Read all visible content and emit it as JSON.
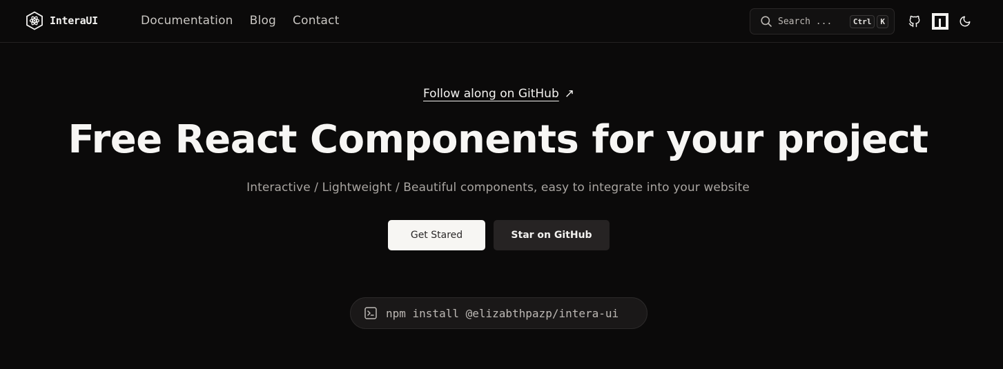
{
  "brand": {
    "name": "InteraUI",
    "logo_icon": "hexagon-atom-logo"
  },
  "nav": {
    "items": [
      {
        "label": "Documentation"
      },
      {
        "label": "Blog"
      },
      {
        "label": "Contact"
      }
    ]
  },
  "search": {
    "placeholder": "Search ...",
    "shortcut_keys": [
      "Ctrl",
      "K"
    ],
    "icon": "search-icon"
  },
  "header_icons": [
    "github-icon",
    "npm-icon",
    "moon-icon"
  ],
  "hero": {
    "github_link": "Follow along on GitHub",
    "github_link_arrow": "↗",
    "title": "Free React Components for your project",
    "subtitle": "Interactive / Lightweight / Beautiful components, easy to integrate into your website",
    "primary_button": "Get Stared",
    "secondary_button": "Star on GitHub",
    "install_command": "npm install @elizabthpazp/intera-ui",
    "install_icon": "terminal-icon"
  },
  "colors": {
    "background": "#0b0a0a",
    "text": "#f3f2f0",
    "muted": "#a9a5a1",
    "primary_button_bg": "#f7f6f3",
    "secondary_button_bg": "#262323"
  }
}
